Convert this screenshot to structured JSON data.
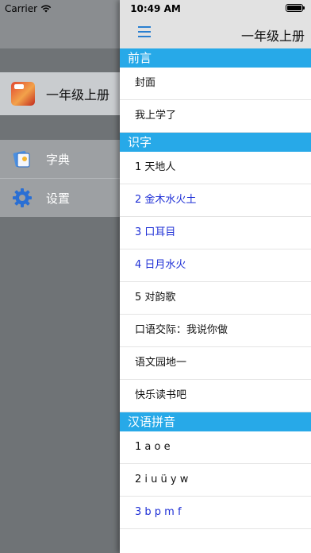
{
  "status_bar": {
    "carrier": "Carrier",
    "time": "10:49 AM"
  },
  "drawer": {
    "book_title": "一年级上册",
    "menu": [
      {
        "label": "字典",
        "icon": "dictionary-icon"
      },
      {
        "label": "设置",
        "icon": "gear-icon"
      }
    ]
  },
  "nav": {
    "title": "一年级上册",
    "menu_icon": "hamburger-menu-icon"
  },
  "colors": {
    "accent": "#27a9e8",
    "link_blue": "#1e2fd6",
    "drawer_bg": "#6f7376"
  },
  "sections": [
    {
      "title": "前言",
      "items": [
        {
          "label": "封面",
          "highlight": false
        },
        {
          "label": "我上学了",
          "highlight": false
        }
      ]
    },
    {
      "title": "识字",
      "items": [
        {
          "label": "1 天地人",
          "highlight": false
        },
        {
          "label": "2 金木水火土",
          "highlight": true
        },
        {
          "label": "3 口耳目",
          "highlight": true
        },
        {
          "label": "4 日月水火",
          "highlight": true
        },
        {
          "label": "5 对韵歌",
          "highlight": false
        },
        {
          "label": "口语交际：我说你做",
          "highlight": false
        },
        {
          "label": "语文园地一",
          "highlight": false
        },
        {
          "label": "快乐读书吧",
          "highlight": false
        }
      ]
    },
    {
      "title": "汉语拼音",
      "items": [
        {
          "label": "1 a o e",
          "highlight": false
        },
        {
          "label": "2 i u ü y w",
          "highlight": false
        },
        {
          "label": "3 b p m f",
          "highlight": true
        }
      ]
    }
  ]
}
